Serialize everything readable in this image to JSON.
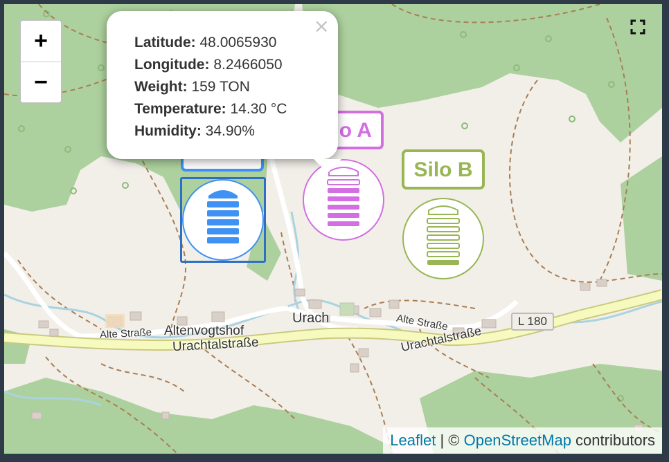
{
  "map": {
    "controls": {
      "zoom_in": "+",
      "zoom_out": "−"
    },
    "place_labels": [
      "Altenvogtshof",
      "Urach"
    ],
    "road_labels": [
      "Urachtalstraße",
      "Urachtalstraße",
      "Alte Straße",
      "Alte Straße"
    ],
    "road_shield": "L 180",
    "colors": {
      "land": "#f2efe9",
      "forest": "#add19e",
      "main_road": "#f7fabf",
      "main_road_casing": "#cbc97f",
      "stream": "#aad3df",
      "track": "#a87e54"
    }
  },
  "markers": [
    {
      "label": "Silo A",
      "color": "#d36ee3",
      "fill_level": 0.62
    },
    {
      "label": "Silo B",
      "color": "#98b654",
      "fill_level": 0.15
    },
    {
      "label": "",
      "color": "#3f91f3",
      "fill_level": 1.0,
      "selected": true
    }
  ],
  "popup": {
    "close": "×",
    "rows": [
      {
        "key": "Latitude:",
        "value": "48.0065930"
      },
      {
        "key": "Longitude:",
        "value": "8.2466050"
      },
      {
        "key": "Weight:",
        "value": "159 TON"
      },
      {
        "key": "Temperature:",
        "value": "14.30 °C"
      },
      {
        "key": "Humidity:",
        "value": "34.90%"
      }
    ]
  },
  "attribution": {
    "leaflet": "Leaflet",
    "separator": " | © ",
    "osm": "OpenStreetMap",
    "suffix": " contributors"
  }
}
